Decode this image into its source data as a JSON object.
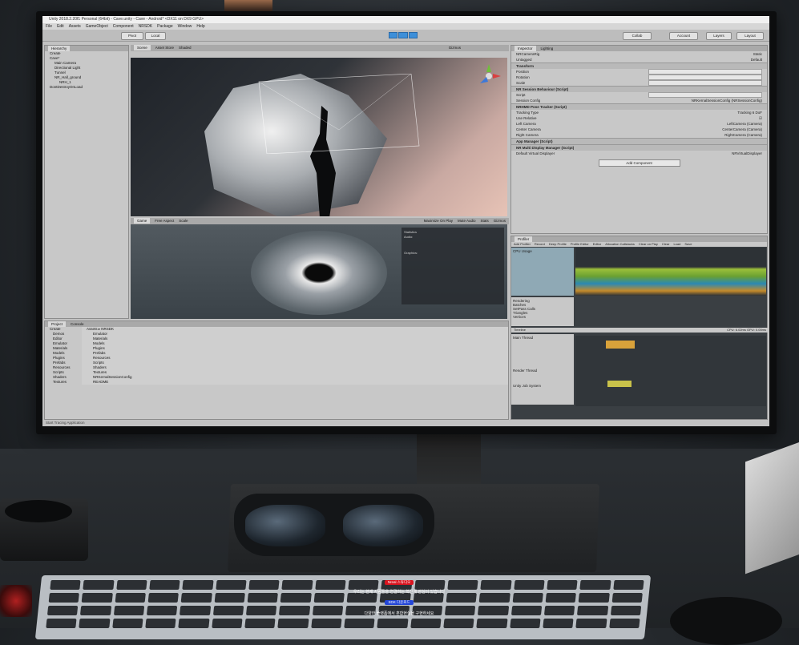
{
  "window": {
    "title": "Unity 2018.2.20f1 Personal (64bit) - Cave.unity - Cave - Android* <DX11 on DX9 GPU>"
  },
  "menu": [
    "File",
    "Edit",
    "Assets",
    "GameObject",
    "Component",
    "NRSDK",
    "Package",
    "Window",
    "Help"
  ],
  "toolbar": {
    "pivot": "Pivot",
    "local": "Local",
    "collab": "Collab",
    "account": "Account",
    "layers": "Layers",
    "layout": "Layout"
  },
  "hierarchy": {
    "tab": "Hierarchy",
    "create": "Create",
    "items": [
      "Cave*",
      "Main Camera",
      "Directional Light",
      "Tunnel",
      "NR_Hall_ground",
      "NRH_1",
      "DontDestroyOnLoad"
    ]
  },
  "scene": {
    "tabs": [
      "Scene",
      "Asset Store"
    ],
    "shading": "Shaded",
    "gizmos": "Gizmos"
  },
  "game": {
    "tab": "Game",
    "display": "Free Aspect",
    "scale": "Scale",
    "options": [
      "Maximize On Play",
      "Mute Audio",
      "Stats",
      "Gizmos"
    ],
    "stats_title": "Statistics",
    "stats_audio": "Audio:",
    "stats_graphics": "Graphics:"
  },
  "project": {
    "tabs": [
      "Project",
      "Console"
    ],
    "create": "Create",
    "path": [
      "Assets",
      "NRSDK"
    ],
    "folders": [
      "Demos",
      "Editor",
      "Emulator",
      "Materials",
      "Models",
      "Plugins",
      "Prefabs",
      "Resources",
      "Scripts",
      "Shaders",
      "Textures"
    ],
    "files": [
      "Emulator",
      "Materials",
      "Models",
      "Plugins",
      "Prefabs",
      "Resources",
      "Scripts",
      "Shaders",
      "Textures",
      "NRKernalSessionConfig",
      "README"
    ]
  },
  "inspector": {
    "tabs": [
      "Inspector",
      "Lighting"
    ],
    "object": "NRCameraRig",
    "static": "Static",
    "tag": "Untagged",
    "layer": "Default",
    "transform": "Transform",
    "position": "Position",
    "rotation": "Rotation",
    "scale": "Scale",
    "session_behaviour": "NR Session Behaviour (Script)",
    "script": "Script",
    "session_config": "Session Config",
    "session_config_value": "NRKernalSessionConfig (NRSessionConfig)",
    "pose_tracker": "NRHMD Pose Tracker (Script)",
    "tracking_type": "Tracking Type",
    "tracking_value": "Tracking 6 DoF",
    "use_relative": "Use Relative",
    "left_camera": "Left Camera",
    "left_camera_value": "LeftCamera (Camera)",
    "center_camera": "Center Camera",
    "center_camera_value": "CenterCamera (Camera)",
    "right_camera": "Right Camera",
    "right_camera_value": "RightCamera (Camera)",
    "app_manager": "App Manager (Script)",
    "multi_display": "NR Multi Display Manager (Script)",
    "default_display": "Default Virtual Displayer",
    "default_display_value": "NRVirtualDisplayer",
    "add_component": "Add Component"
  },
  "profiler": {
    "tab": "Profiler",
    "add": "Add Profiler",
    "buttons": [
      "Record",
      "Deep Profile",
      "Profile Editor",
      "Editor",
      "Allocation Callstacks",
      "Clear on Play",
      "Clear",
      "Load",
      "Save"
    ],
    "cpu": "CPU Usage",
    "rendering": "Rendering",
    "rendering_items": [
      "Batches",
      "SetPass Calls",
      "Triangles",
      "Vertices"
    ],
    "timeline": "Timeline",
    "cpu_time": "CPU: 6.02ms   GPU: 0.00ms",
    "main_thread": "Main Thread",
    "render_thread": "Render Thread",
    "job_system": "Unity Job System"
  },
  "status": "Start Tracing Application",
  "caption": {
    "badge1": "Nreal 스튜디오",
    "line1": "우리는 현재 사람들을 연결하는 혁신에 관심이 있습니다",
    "badge2": "SDK 다운로드",
    "line2": "다양한 플랫폼에서 혼합현실을 구현하세요"
  },
  "colors": {
    "unity_panel": "#c8c8c8",
    "play_blue": "#3d8fd9",
    "badge_red": "#d9141f",
    "badge_blue": "#2346d9"
  }
}
